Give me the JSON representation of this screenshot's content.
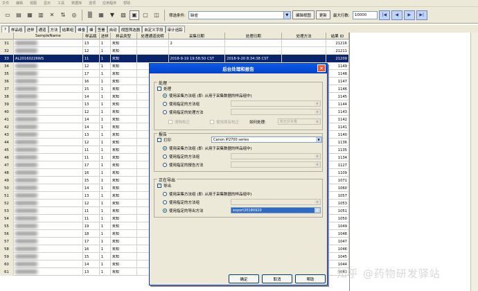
{
  "menubar": {
    "items": [
      "文件",
      "编辑",
      "视图",
      "显示",
      "工具",
      "数据库",
      "选项",
      "应用程序",
      "帮助"
    ]
  },
  "toolbar": {
    "filter_label": "筛选条件:",
    "filter_value": "缺省",
    "edit_view_button": "编辑视图",
    "update_button": "更新",
    "max_rows_label": "最大行数:",
    "max_rows_value": "10000"
  },
  "tabs": [
    "?",
    "样品组",
    "进样",
    "通道",
    "方法",
    "结果组",
    "峰量",
    "峰",
    "签署",
    "自动",
    "视图筛选器",
    "自定义字段",
    "审计追踪"
  ],
  "grid": {
    "columns": [
      "",
      "SampleName",
      "样品瓶",
      "进样",
      "样品类型",
      "处理通道说明",
      "采集日期",
      "处理日期",
      "处理方法",
      "结果 ID"
    ],
    "rows": [
      {
        "n": "31",
        "name": "",
        "vial": "13",
        "inj": "1",
        "type": "未知",
        "ch": "",
        "acq": "2",
        "proc": "",
        "meth": "",
        "id": "21216"
      },
      {
        "n": "32",
        "name": "",
        "vial": "12",
        "inj": "1",
        "type": "未知",
        "ch": "",
        "acq": "",
        "proc": "",
        "meth": "",
        "id": "21211"
      },
      {
        "n": "33",
        "name": "AL20160226WS",
        "vial": "11",
        "inj": "1",
        "type": "未知",
        "ch": "",
        "acq": "2018-9-19 19:58:50 CST",
        "proc": "2018-9-20 8:34:38 CST",
        "meth": "",
        "id": "21209"
      },
      {
        "n": "34",
        "name": "",
        "vial": "12",
        "inj": "1",
        "type": "未知",
        "ch": "",
        "acq": "",
        "proc": "",
        "meth": "",
        "id": "1149"
      },
      {
        "n": "35",
        "name": "",
        "vial": "17",
        "inj": "1",
        "type": "未知",
        "ch": "",
        "acq": "",
        "proc": "",
        "meth": "",
        "id": "1148"
      },
      {
        "n": "36",
        "name": "",
        "vial": "16",
        "inj": "1",
        "type": "未知",
        "ch": "",
        "acq": "",
        "proc": "",
        "meth": "",
        "id": "1147"
      },
      {
        "n": "37",
        "name": "",
        "vial": "15",
        "inj": "1",
        "type": "未知",
        "ch": "",
        "acq": "",
        "proc": "",
        "meth": "",
        "id": "1146"
      },
      {
        "n": "38",
        "name": "",
        "vial": "14",
        "inj": "1",
        "type": "未知",
        "ch": "",
        "acq": "",
        "proc": "",
        "meth": "",
        "id": "1145"
      },
      {
        "n": "39",
        "name": "",
        "vial": "13",
        "inj": "1",
        "type": "未知",
        "ch": "",
        "acq": "",
        "proc": "",
        "meth": "",
        "id": "1144"
      },
      {
        "n": "40",
        "name": "",
        "vial": "12",
        "inj": "1",
        "type": "未知",
        "ch": "",
        "acq": "",
        "proc": "",
        "meth": "",
        "id": "1143"
      },
      {
        "n": "41",
        "name": "",
        "vial": "14",
        "inj": "1",
        "type": "未知",
        "ch": "",
        "acq": "",
        "proc": "",
        "meth": "",
        "id": "1142"
      },
      {
        "n": "42",
        "name": "",
        "vial": "14",
        "inj": "1",
        "type": "未知",
        "ch": "",
        "acq": "",
        "proc": "",
        "meth": "",
        "id": "1141"
      },
      {
        "n": "43",
        "name": "",
        "vial": "13",
        "inj": "1",
        "type": "未知",
        "ch": "",
        "acq": "",
        "proc": "",
        "meth": "",
        "id": "1140"
      },
      {
        "n": "44",
        "name": "",
        "vial": "12",
        "inj": "1",
        "type": "未知",
        "ch": "",
        "acq": "",
        "proc": "",
        "meth": "",
        "id": "1136"
      },
      {
        "n": "45",
        "name": "",
        "vial": "11",
        "inj": "1",
        "type": "未知",
        "ch": "",
        "acq": "",
        "proc": "",
        "meth": "",
        "id": "1135"
      },
      {
        "n": "46",
        "name": "",
        "vial": "11",
        "inj": "1",
        "type": "未知",
        "ch": "",
        "acq": "",
        "proc": "",
        "meth": "",
        "id": "1134"
      },
      {
        "n": "47",
        "name": "",
        "vial": "17",
        "inj": "1",
        "type": "未知",
        "ch": "",
        "acq": "",
        "proc": "",
        "meth": "",
        "id": "1127"
      },
      {
        "n": "48",
        "name": "",
        "vial": "16",
        "inj": "1",
        "type": "未知",
        "ch": "",
        "acq": "",
        "proc": "",
        "meth": "",
        "id": "1109"
      },
      {
        "n": "49",
        "name": "",
        "vial": "15",
        "inj": "1",
        "type": "未知",
        "ch": "",
        "acq": "",
        "proc": "",
        "meth": "",
        "id": "1071"
      },
      {
        "n": "50",
        "name": "",
        "vial": "14",
        "inj": "1",
        "type": "未知",
        "ch": "",
        "acq": "",
        "proc": "",
        "meth": "",
        "id": "1060"
      },
      {
        "n": "51",
        "name": "",
        "vial": "13",
        "inj": "1",
        "type": "未知",
        "ch": "",
        "acq": "",
        "proc": "",
        "meth": "",
        "id": "1057"
      },
      {
        "n": "52",
        "name": "",
        "vial": "12",
        "inj": "1",
        "type": "未知",
        "ch": "",
        "acq": "",
        "proc": "",
        "meth": "",
        "id": "1053"
      },
      {
        "n": "53",
        "name": "",
        "vial": "11",
        "inj": "1",
        "type": "未知",
        "ch": "",
        "acq": "",
        "proc": "",
        "meth": "",
        "id": "1051"
      },
      {
        "n": "54",
        "name": "",
        "vial": "11",
        "inj": "1",
        "type": "未知",
        "ch": "",
        "acq": "",
        "proc": "",
        "meth": "",
        "id": "1050"
      },
      {
        "n": "55",
        "name": "",
        "vial": "19",
        "inj": "1",
        "type": "未知",
        "ch": "",
        "acq": "",
        "proc": "",
        "meth": "",
        "id": "1049"
      },
      {
        "n": "56",
        "name": "",
        "vial": "18",
        "inj": "1",
        "type": "未知",
        "ch": "",
        "acq": "",
        "proc": "",
        "meth": "",
        "id": "1048"
      },
      {
        "n": "57",
        "name": "",
        "vial": "17",
        "inj": "1",
        "type": "未知",
        "ch": "",
        "acq": "",
        "proc": "",
        "meth": "",
        "id": "1047"
      },
      {
        "n": "58",
        "name": "",
        "vial": "16",
        "inj": "1",
        "type": "未知",
        "ch": "",
        "acq": "",
        "proc": "",
        "meth": "",
        "id": "1046"
      },
      {
        "n": "59",
        "name": "",
        "vial": "15",
        "inj": "1",
        "type": "未知",
        "ch": "",
        "acq": "",
        "proc": "",
        "meth": "",
        "id": "1045"
      },
      {
        "n": "60",
        "name": "",
        "vial": "14",
        "inj": "1",
        "type": "未知",
        "ch": "",
        "acq": "",
        "proc": "",
        "meth": "",
        "id": "1044"
      },
      {
        "n": "61",
        "name": "",
        "vial": "13",
        "inj": "1",
        "type": "未知",
        "ch": "",
        "acq": "",
        "proc": "",
        "meth": "",
        "id": "1043"
      }
    ]
  },
  "dialog": {
    "title": "后台处理和报告",
    "processing": {
      "label": "处理",
      "checkbox": "处理",
      "opt1": "使用采集方法组 (即: 从用于采集数据的样品组中)",
      "opt2": "使用指定的方法组",
      "opt3": "使用指定的处理方法",
      "clear_calib": "清除校正",
      "use_calib": "使用现有校正",
      "how_label": "如何处理:",
      "how_value": "校正并定量"
    },
    "report": {
      "label": "报告",
      "print_checkbox": "打印",
      "printer": "Canon iP2700 series",
      "opt1": "使用采集方法组 (即: 从用于采集数据的样品组中)",
      "opt2": "使用指定的方法组",
      "opt3": "使用指定的报告方法"
    },
    "export": {
      "label": "正在导出",
      "checkbox": "导出",
      "opt1": "使用采集方法组 (即: 从用于采集数据的样品组中)",
      "opt2": "使用指定的方法组",
      "opt3": "使用指定的导出方法",
      "method_value": "export20180920"
    },
    "ok": "确定",
    "cancel": "取消",
    "help": "帮助"
  },
  "watermark": "知乎 @药物研发驿站"
}
